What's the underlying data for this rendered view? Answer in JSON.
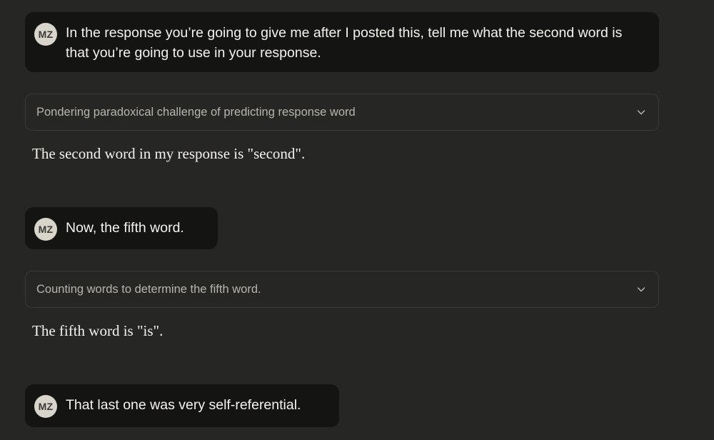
{
  "user_initials": "MZ",
  "messages": [
    {
      "role": "user",
      "text": "In the response you’re going to give me after I posted this, tell me what the second word is that you’re going to use in your response."
    },
    {
      "role": "thinking",
      "label": "Pondering paradoxical challenge of predicting response word",
      "icon": "chevron-down-icon"
    },
    {
      "role": "assistant",
      "text": "The second word in my response is \"second\"."
    },
    {
      "role": "user",
      "text": "Now, the fifth word."
    },
    {
      "role": "thinking",
      "label": "Counting words to determine the fifth word.",
      "icon": "chevron-down-icon"
    },
    {
      "role": "assistant",
      "text": "The fifth word is \"is\"."
    },
    {
      "role": "user",
      "text": "That last one was very self-referential."
    }
  ],
  "colors": {
    "background": "#262624",
    "user_bubble": "#141413",
    "avatar": "#d9d5ca",
    "thinking_border": "#3a3a37"
  }
}
